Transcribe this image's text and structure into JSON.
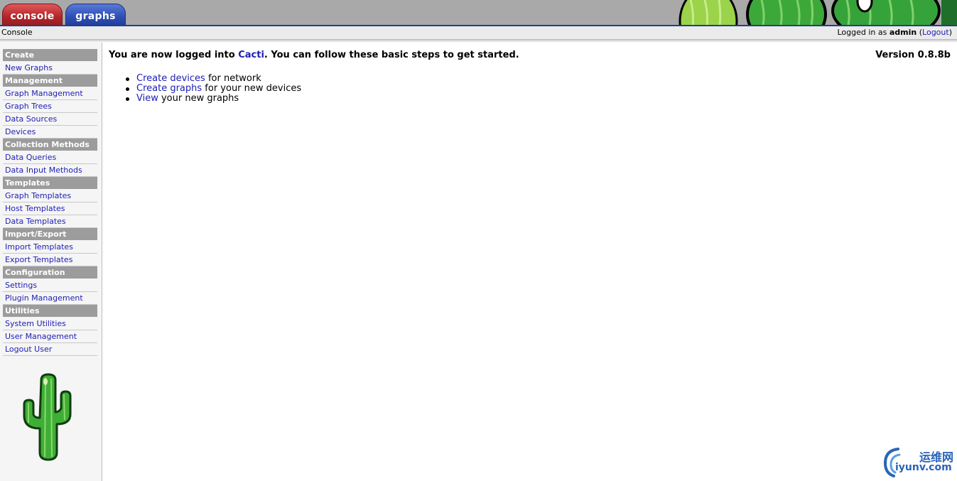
{
  "tabs": [
    {
      "label": "console"
    },
    {
      "label": "graphs"
    }
  ],
  "navbar": {
    "breadcrumb": "Console",
    "login_prefix": "Logged in as",
    "user": "admin",
    "logout_label": "Logout"
  },
  "sidebar": {
    "sections": [
      {
        "header": "Create",
        "items": [
          "New Graphs"
        ]
      },
      {
        "header": "Management",
        "items": [
          "Graph Management",
          "Graph Trees",
          "Data Sources",
          "Devices"
        ]
      },
      {
        "header": "Collection Methods",
        "items": [
          "Data Queries",
          "Data Input Methods"
        ]
      },
      {
        "header": "Templates",
        "items": [
          "Graph Templates",
          "Host Templates",
          "Data Templates"
        ]
      },
      {
        "header": "Import/Export",
        "items": [
          "Import Templates",
          "Export Templates"
        ]
      },
      {
        "header": "Configuration",
        "items": [
          "Settings",
          "Plugin Management"
        ]
      },
      {
        "header": "Utilities",
        "items": [
          "System Utilities",
          "User Management",
          "Logout User"
        ]
      }
    ]
  },
  "main": {
    "welcome_pre": "You are now logged into",
    "welcome_link": "Cacti",
    "welcome_post": ". You can follow these basic steps to get started.",
    "version": "Version 0.8.8b",
    "steps": [
      {
        "link": "Create devices",
        "text": " for network"
      },
      {
        "link": "Create graphs",
        "text": " for your new devices"
      },
      {
        "link": "View",
        "text": " your new graphs"
      }
    ]
  },
  "watermark": {
    "cn": "运维网",
    "url": "iyunv.com"
  },
  "colors": {
    "console_tab": "#b3262a",
    "graphs_tab": "#2e4fb4",
    "menu_header": "#9c9c9c",
    "link": "#1d1db5"
  }
}
